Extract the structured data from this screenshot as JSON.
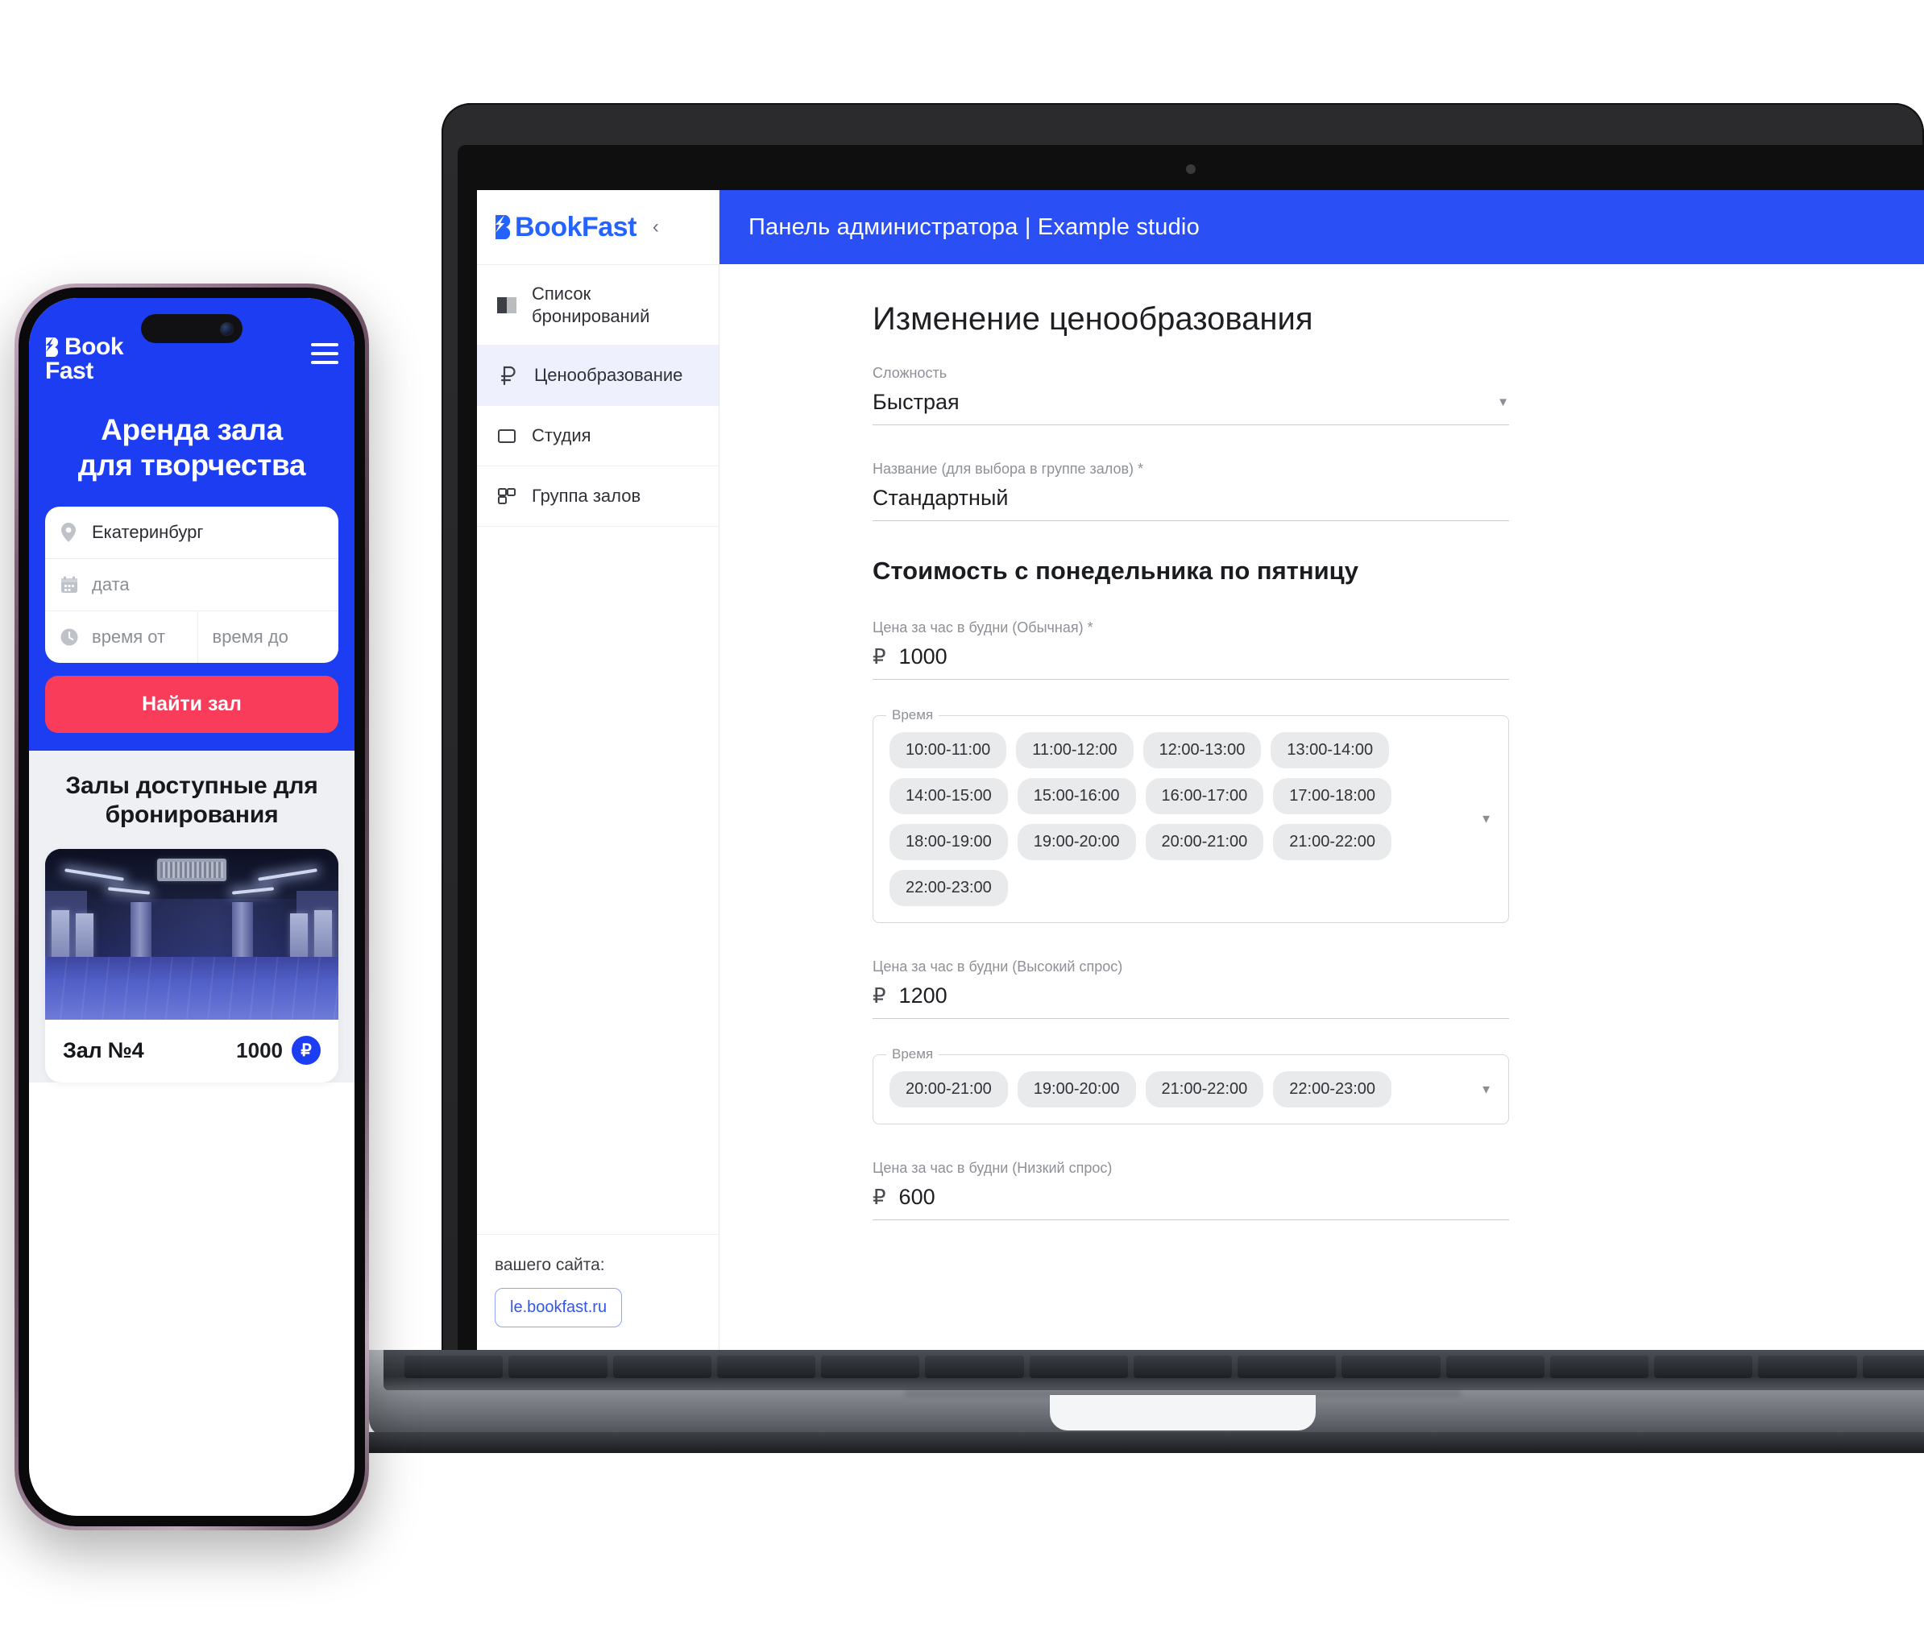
{
  "brand": {
    "name": "BookFast",
    "name_line1": "Book",
    "name_line2": "Fast",
    "accent_color": "#2563ff",
    "hero_color": "#1d3df2",
    "cta_color": "#fa3c5b"
  },
  "laptop": {
    "sidebar": {
      "collapse_icon": "chevron-left-icon",
      "items": [
        {
          "label": "Список бронирований",
          "icon": "book-icon",
          "active": false
        },
        {
          "label": "Ценообразование",
          "icon": "ruble-icon",
          "active": true
        },
        {
          "label": "Студия",
          "icon": "studio-icon",
          "active": false
        },
        {
          "label": "Группа залов",
          "icon": "group-icon",
          "active": false
        }
      ],
      "footer_label": "вашего сайта:",
      "footer_link": "le.bookfast.ru"
    },
    "topbar": {
      "title": "Панель администратора | Example studio"
    },
    "form": {
      "page_title": "Изменение ценообразования",
      "fields": [
        {
          "label": "Сложность",
          "value": "Быстрая",
          "has_caret": true
        },
        {
          "label": "Название (для выбора в группе залов) *",
          "value": "Стандартный",
          "has_caret": false
        }
      ],
      "section_title": "Стоимость с понедельника по пятницу",
      "price_blocks": [
        {
          "label": "Цена за час в будни (Обычная) *",
          "currency": "₽",
          "value": "1000",
          "time_legend": "Время",
          "times": [
            "10:00-11:00",
            "11:00-12:00",
            "12:00-13:00",
            "13:00-14:00",
            "14:00-15:00",
            "15:00-16:00",
            "16:00-17:00",
            "17:00-18:00",
            "18:00-19:00",
            "19:00-20:00",
            "20:00-21:00",
            "21:00-22:00",
            "22:00-23:00"
          ]
        },
        {
          "label": "Цена за час в будни (Высокий спрос)",
          "currency": "₽",
          "value": "1200",
          "time_legend": "Время",
          "times": [
            "20:00-21:00",
            "19:00-20:00",
            "21:00-22:00",
            "22:00-23:00"
          ]
        },
        {
          "label": "Цена за час в будни (Низкий спрос)",
          "currency": "₽",
          "value": "600",
          "time_legend": "",
          "times": []
        }
      ]
    }
  },
  "phone": {
    "logo_line1": "Book",
    "logo_line2": "Fast",
    "menu_icon": "hamburger-menu-icon",
    "hero_title_line1": "Аренда зала",
    "hero_title_line2": "для творчества",
    "search": {
      "city_value": "Екатеринбург",
      "city_icon": "location-pin-icon",
      "date_placeholder": "дата",
      "date_icon": "calendar-icon",
      "time_from_placeholder": "время от",
      "time_to_placeholder": "время до",
      "time_icon": "clock-icon",
      "submit_label": "Найти зал"
    },
    "listing": {
      "title_line1": "Залы доступные для",
      "title_line2": "бронирования",
      "cards": [
        {
          "name": "Зал №4",
          "price": "1000",
          "currency": "₽"
        }
      ]
    }
  }
}
